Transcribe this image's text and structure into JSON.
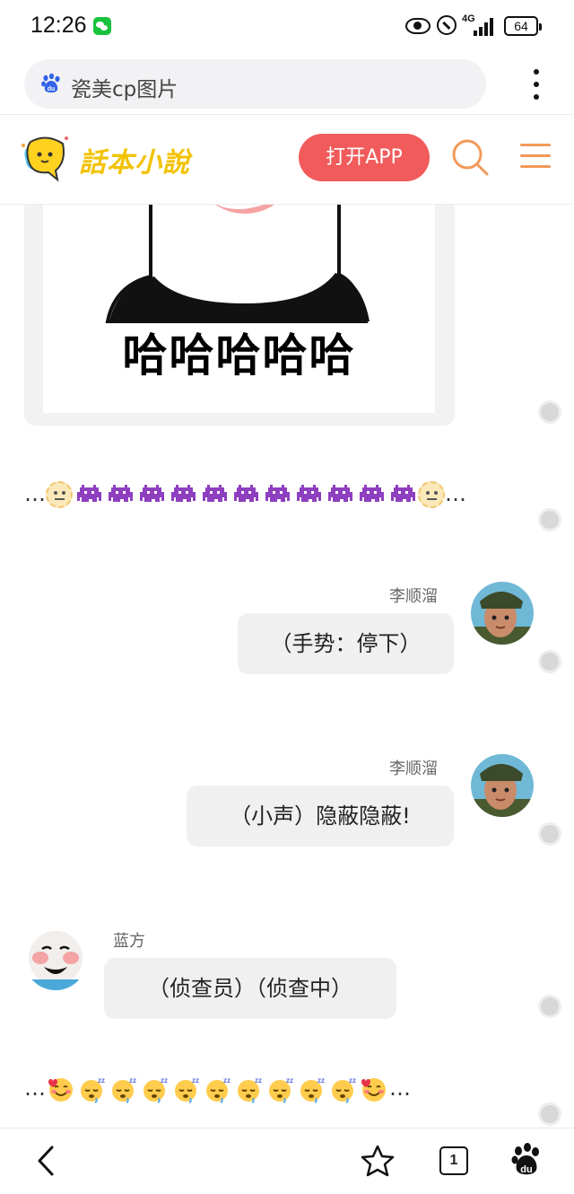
{
  "status_bar": {
    "time": "12:26",
    "network": "4G",
    "battery": "64"
  },
  "browser": {
    "search_text": "瓷美cp图片",
    "icons": [
      "baidu-icon",
      "more-vert-icon"
    ]
  },
  "site": {
    "logo_text": "話本小說",
    "open_app_label": "打开APP",
    "icons": [
      "search-icon",
      "menu-icon"
    ]
  },
  "content": {
    "meme_caption": "哈哈哈哈哈",
    "emoji_line_1": {
      "leading": "…",
      "trailing": "…",
      "icons": [
        "neutral-face",
        "alien-monster-x11",
        "neutral-face"
      ]
    },
    "messages": [
      {
        "side": "right",
        "name": "李顺溜",
        "text": "（手势：停下）"
      },
      {
        "side": "right",
        "name": "李顺溜",
        "text": "（小声）隐蔽隐蔽!"
      },
      {
        "side": "left",
        "name": "蓝方",
        "text": "（侦查员）（侦查中）"
      }
    ],
    "emoji_line_2": {
      "leading": "…",
      "trailing": "…",
      "icons": [
        "smiling-face-with-hearts",
        "sleeping-face-x9",
        "smiling-face-with-hearts"
      ]
    }
  },
  "bottom_nav": {
    "tab_count": "1",
    "icons": [
      "back-icon",
      "star-icon",
      "tabs-icon",
      "baidu-paw-icon"
    ]
  }
}
